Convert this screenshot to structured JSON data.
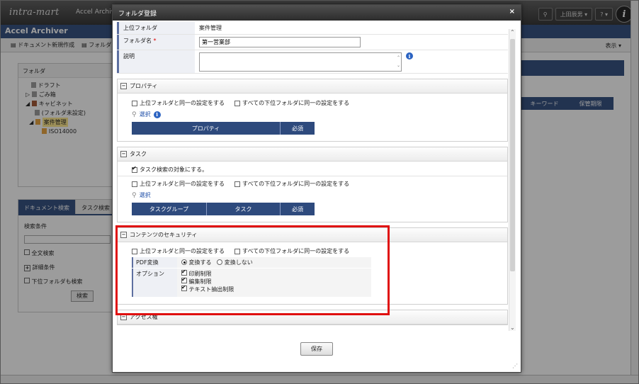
{
  "app": {
    "logo": "intra-mart",
    "product": "Accel Archiver",
    "app_title": "Accel Archiver",
    "user": "上田辰男",
    "help": "?",
    "toolbar": {
      "new_doc": "ドキュメント新規作成",
      "folder": "フォルダメ",
      "display": "表示"
    },
    "folder_panel": {
      "title": "フォルダ",
      "tree": [
        "ドラフト",
        "ごみ箱",
        "キャビネット",
        "(フォルダ未設定)",
        "案件管理",
        "ISO14000"
      ]
    },
    "search_panel": {
      "tabs": [
        "ドキュメント検索",
        "タスク検索"
      ],
      "condition": "検索条件",
      "fulltext": "全文検索",
      "detail": "詳細条件",
      "subfolders": "下位フォルダも検索",
      "search_btn": "検索"
    },
    "grid_headers": [
      "キーワード",
      "保管期限"
    ]
  },
  "dialog": {
    "title": "フォルダ登録",
    "close": "×",
    "fields": {
      "parent_label": "上位フォルダ",
      "parent_value": "案件管理",
      "name_label": "フォルダ名",
      "name_required": "*",
      "name_value": "第一営業部",
      "desc_label": "説明",
      "desc_value": ""
    },
    "properties": {
      "title": "プロパティ",
      "same_as_parent": "上位フォルダと同一の設定をする",
      "same_for_children": "すべての下位フォルダに同一の設定をする",
      "select": "選択",
      "columns": [
        "プロパティ",
        "必須"
      ]
    },
    "task": {
      "title": "タスク",
      "search_target": "タスク検索の対象にする。",
      "same_as_parent": "上位フォルダと同一の設定をする",
      "same_for_children": "すべての下位フォルダに同一の設定をする",
      "select": "選択",
      "columns": [
        "タスクグループ",
        "タスク",
        "必須"
      ]
    },
    "security": {
      "title": "コンテンツのセキュリティ",
      "same_as_parent": "上位フォルダと同一の設定をする",
      "same_for_children": "すべての下位フォルダに同一の設定をする",
      "pdf_label": "PDF変換",
      "pdf_convert": "変換する",
      "pdf_no_convert": "変換しない",
      "option_label": "オプション",
      "options": [
        "印刷制限",
        "編集制限",
        "テキスト抽出制限"
      ]
    },
    "access": {
      "title": "アクセス権"
    },
    "save": "保存"
  }
}
